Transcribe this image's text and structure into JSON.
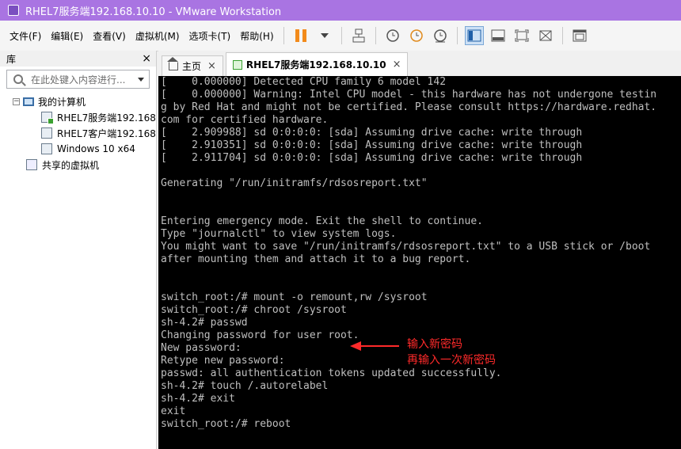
{
  "window": {
    "title": "RHEL7服务端192.168.10.10 - VMware Workstation"
  },
  "menu": [
    "文件(F)",
    "编辑(E)",
    "查看(V)",
    "虚拟机(M)",
    "选项卡(T)",
    "帮助(H)"
  ],
  "library": {
    "title": "库",
    "close": "×",
    "search_placeholder": "在此处键入内容进行...",
    "tree": {
      "root": "我的计算机",
      "vms": [
        "RHEL7服务端192.168",
        "RHEL7客户端192.168",
        "Windows 10 x64"
      ],
      "shared": "共享的虚拟机"
    }
  },
  "tabs": {
    "home": "主页",
    "active": "RHEL7服务端192.168.10.10",
    "close": "×"
  },
  "console_lines": [
    "[    0.000000] Detected CPU family 6 model 142",
    "[    0.000000] Warning: Intel CPU model - this hardware has not undergone testin",
    "g by Red Hat and might not be certified. Please consult https://hardware.redhat.",
    "com for certified hardware.",
    "[    2.909988] sd 0:0:0:0: [sda] Assuming drive cache: write through",
    "[    2.910351] sd 0:0:0:0: [sda] Assuming drive cache: write through",
    "[    2.911704] sd 0:0:0:0: [sda] Assuming drive cache: write through",
    "",
    "Generating \"/run/initramfs/rdsosreport.txt\"",
    "",
    "",
    "Entering emergency mode. Exit the shell to continue.",
    "Type \"journalctl\" to view system logs.",
    "You might want to save \"/run/initramfs/rdsosreport.txt\" to a USB stick or /boot",
    "after mounting them and attach it to a bug report.",
    "",
    "",
    "switch_root:/# mount -o remount,rw /sysroot",
    "switch_root:/# chroot /sysroot",
    "sh-4.2# passwd",
    "Changing password for user root.",
    "New password:",
    "Retype new password:",
    "passwd: all authentication tokens updated successfully.",
    "sh-4.2# touch /.autorelabel",
    "sh-4.2# exit",
    "exit",
    "switch_root:/# reboot"
  ],
  "annotations": [
    "输入新密码",
    "再输入一次新密码"
  ],
  "colors": {
    "titlebar": "#a974e2",
    "annotation": "#ff2a2a",
    "pause": "#f28b1b"
  }
}
